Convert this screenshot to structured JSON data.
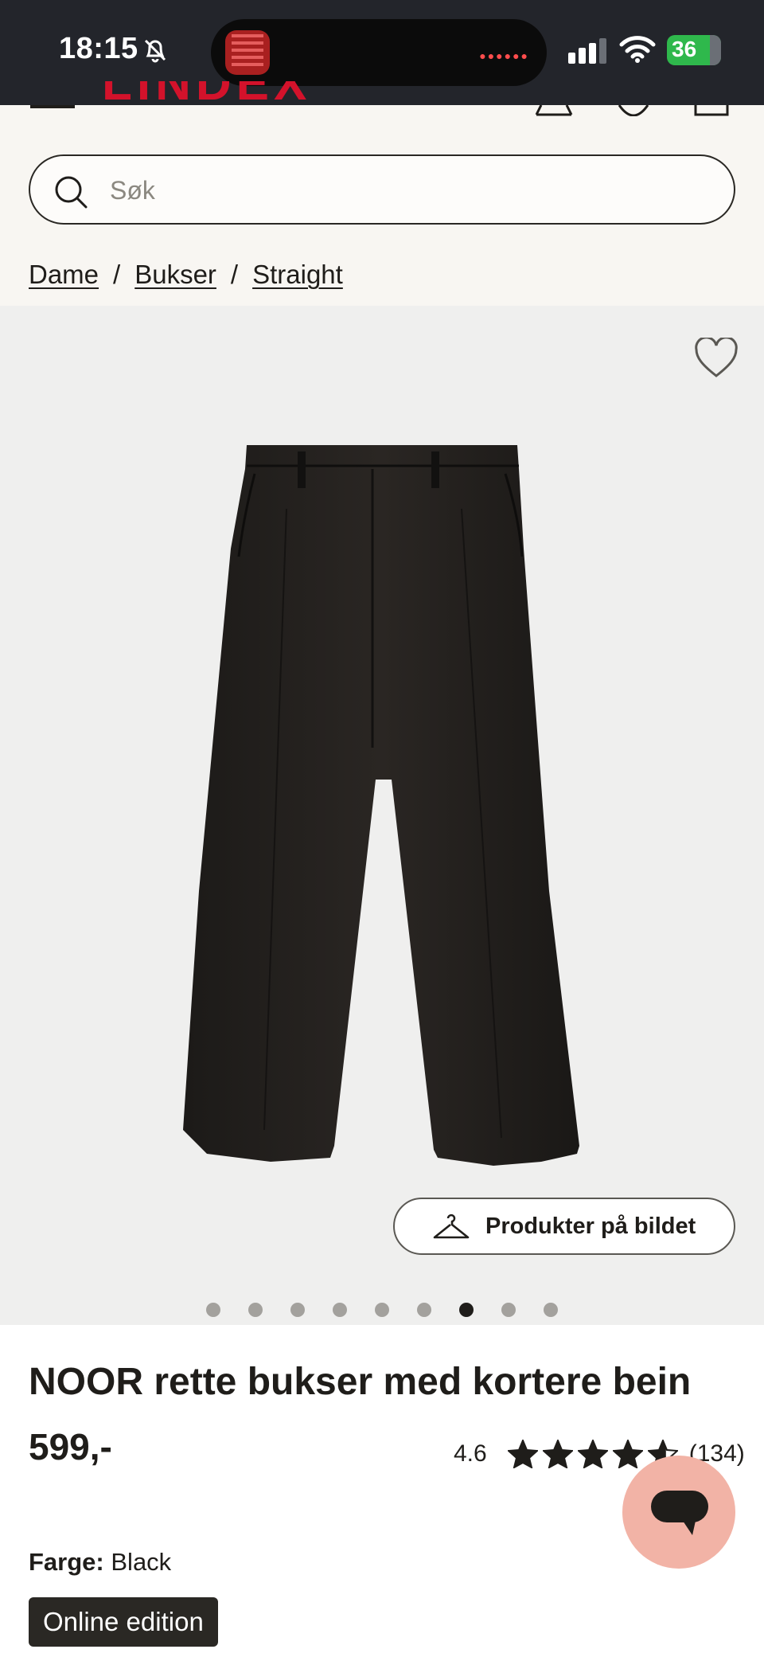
{
  "status_bar": {
    "time": "18:15",
    "battery": "36"
  },
  "header": {
    "brand": "LINDEX",
    "search": {
      "placeholder": "Søk",
      "value": ""
    },
    "breadcrumb": [
      "Dame",
      "Bukser",
      "Straight"
    ],
    "breadcrumb_separator": "/"
  },
  "gallery": {
    "products_in_image_label": "Produkter på bildet",
    "image_count": 9,
    "active_image_index": 6
  },
  "product": {
    "title": "NOOR rette bukser med kortere bein",
    "price": "599,-",
    "rating": "4.6",
    "rating_value": 4.6,
    "review_count": "(134)",
    "color_label": "Farge:",
    "color_value": "Black",
    "badge": "Online edition"
  },
  "colors": {
    "brand_red": "#d3122b",
    "chat_bubble": "#f2b3a6",
    "badge_bg": "#2a2824"
  }
}
